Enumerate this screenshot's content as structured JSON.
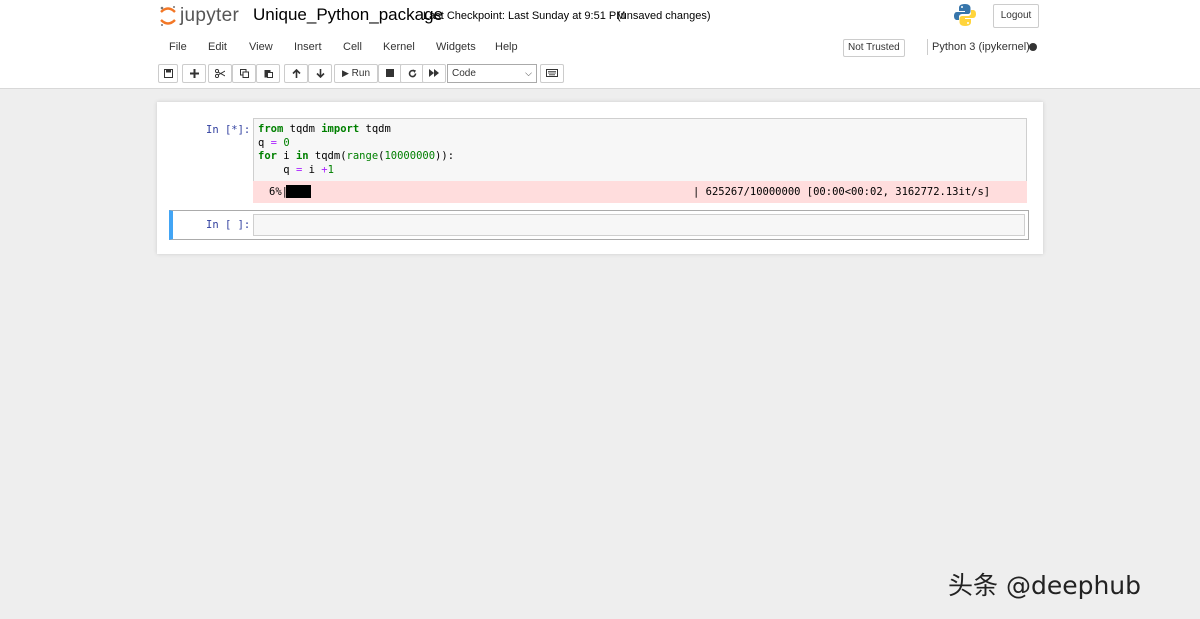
{
  "header": {
    "logo_text": "jupyter",
    "notebook_name": "Unique_Python_package",
    "checkpoint": "Last Checkpoint: Last Sunday at 9:51 PM",
    "unsaved": "(unsaved changes)",
    "logout_label": "Logout"
  },
  "menubar": {
    "items": [
      "File",
      "Edit",
      "View",
      "Insert",
      "Cell",
      "Kernel",
      "Widgets",
      "Help"
    ],
    "trust_label": "Not Trusted",
    "kernel_name": "Python 3 (ipykernel)"
  },
  "toolbar": {
    "run_label": "Run",
    "cell_type": "Code"
  },
  "cells": [
    {
      "prompt": "In [*]:",
      "code_lines": [
        "from tqdm import tqdm",
        "q = 0",
        "for i in tqdm(range(10000000)):",
        "    q = i +1"
      ],
      "output": {
        "percent_label": "6%|",
        "progress_fraction": 0.0625,
        "stats": "| 625267/10000000 [00:00<00:02, 3162772.13it/s]"
      }
    },
    {
      "prompt": "In [ ]:",
      "code_lines": []
    }
  ],
  "watermark": "头条 @deephub",
  "colors": {
    "jupyter_orange": "#f37726",
    "prompt_blue": "#303f9f",
    "stderr_bg": "#ffdddd",
    "selected_cell_border": "#42a5f5",
    "keyword_green": "#008000"
  }
}
